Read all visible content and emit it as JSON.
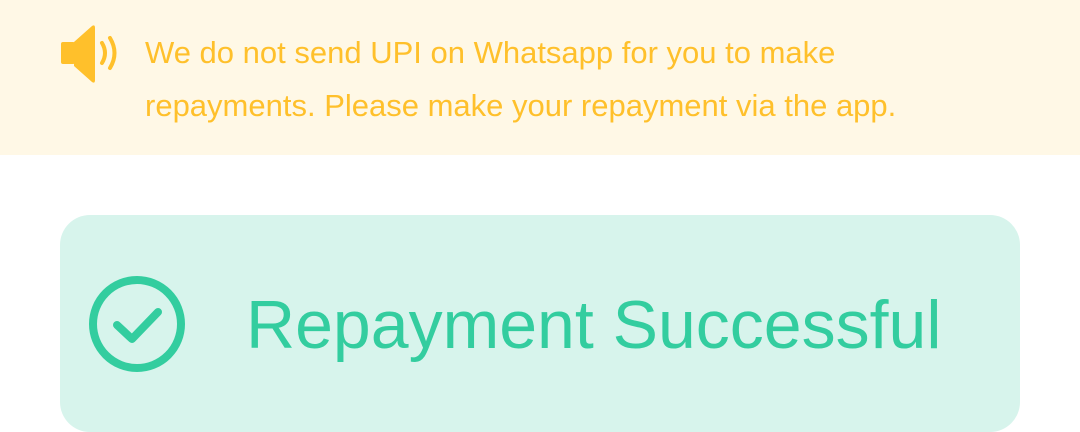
{
  "notice": {
    "icon": "speaker-icon",
    "line1": "We do not send UPI on Whatsapp for you to make",
    "line2": "repayments. Please make your repayment via the app.",
    "color": "#ffc02b",
    "background": "#fff8e6"
  },
  "status": {
    "icon": "check-circle-icon",
    "title": "Repayment Successful",
    "color": "#33cd9f",
    "background": "#d7f4ec"
  }
}
